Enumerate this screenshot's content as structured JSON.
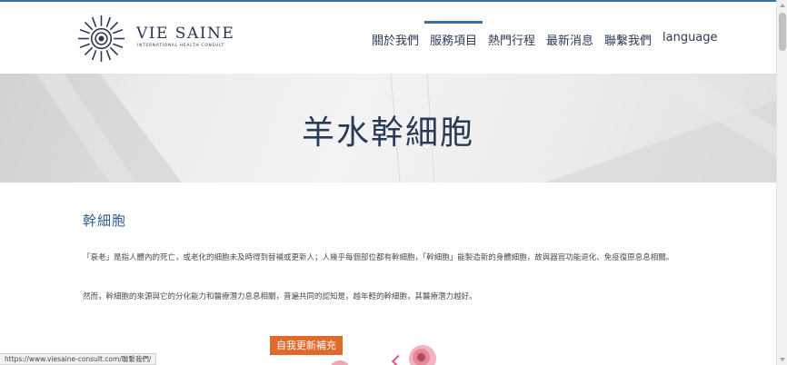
{
  "brand": {
    "name": "VIE SAINE",
    "tagline": "INTERNATIONAL HEALTH CONSULT",
    "icon": "sunburst-logo-icon",
    "color": "#2a3550"
  },
  "nav": {
    "items": [
      {
        "label": "關於我們",
        "active": false
      },
      {
        "label": "服務項目",
        "active": true
      },
      {
        "label": "熱門行程",
        "active": false
      },
      {
        "label": "最新消息",
        "active": false
      },
      {
        "label": "聯繫我們",
        "active": false
      },
      {
        "label": "language",
        "active": false
      }
    ],
    "accent_color": "#3a6ea5"
  },
  "hero": {
    "title": "羊水幹細胞"
  },
  "content": {
    "section_title": "幹細胞",
    "paragraphs": [
      "「衰老」是指人體內的死亡，或老化的細胞未及時得到替補或更新人；人幾乎每個部位都有幹細胞，「幹細胞」能製造新的身體細胞，故與器官功能退化、免疫復原息息相關。",
      "然而，幹細胞的來源與它的分化能力和醫療潛力息息相關，普遍共同的認知是，越年輕的幹細胞，其醫療潛力越好。"
    ]
  },
  "figure": {
    "tag_label": "自我更新補充",
    "tag_color": "#e06a2c"
  },
  "status_bar": {
    "url": "https://www.viesaine-consult.com/聯繫我們/"
  }
}
